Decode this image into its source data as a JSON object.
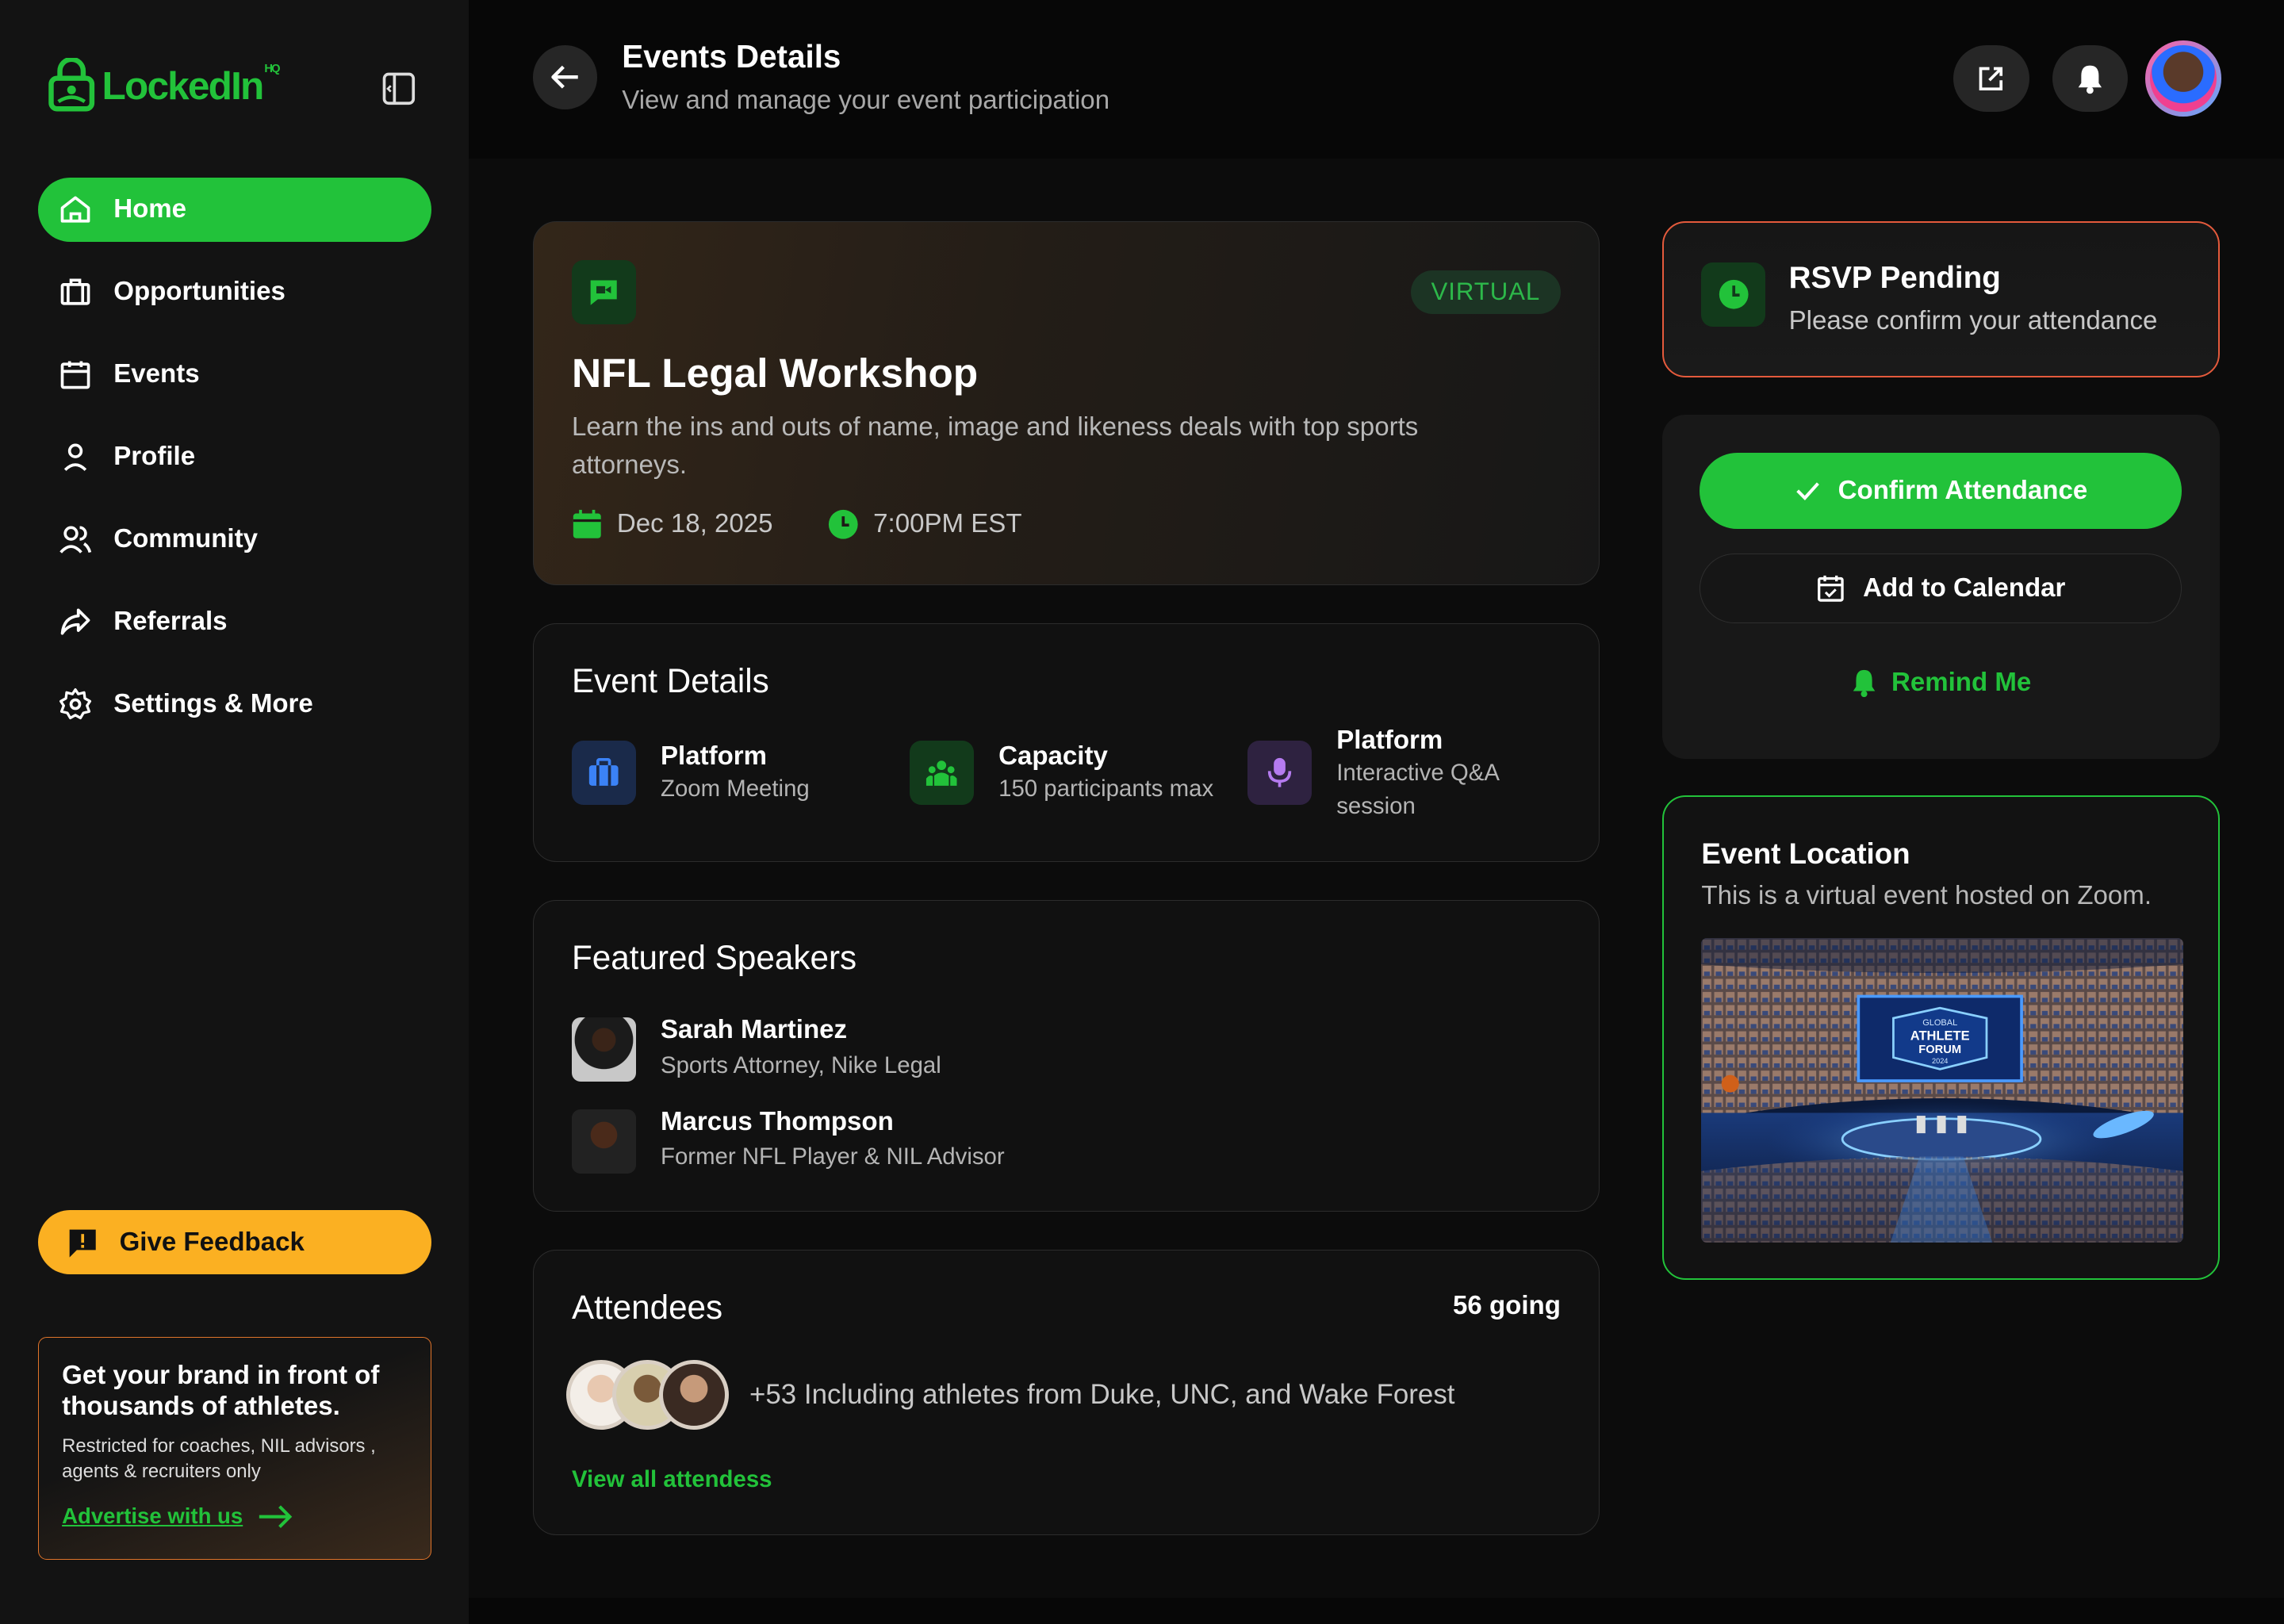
{
  "brand": {
    "name": "LockedIn",
    "superscript": "HQ"
  },
  "sidebar": {
    "items": [
      {
        "label": "Home",
        "icon": "home-icon",
        "active": true
      },
      {
        "label": "Opportunities",
        "icon": "briefcase-icon"
      },
      {
        "label": "Events",
        "icon": "calendar-icon"
      },
      {
        "label": "Profile",
        "icon": "user-icon"
      },
      {
        "label": "Community",
        "icon": "users-icon"
      },
      {
        "label": "Referrals",
        "icon": "share-icon"
      },
      {
        "label": "Settings & More",
        "icon": "gear-icon"
      }
    ],
    "feedback_label": "Give Feedback",
    "promo": {
      "title": "Get your brand in front of thousands of athletes.",
      "subtitle": "Restricted for coaches, NIL advisors , agents & recruiters only",
      "link": "Advertise with us"
    }
  },
  "header": {
    "title": "Events Details",
    "subtitle": "View and manage your event participation"
  },
  "event": {
    "badge": "VIRTUAL",
    "title": "NFL Legal Workshop",
    "description": "Learn the ins and outs of name, image and likeness deals with top sports attorneys.",
    "date": "Dec 18, 2025",
    "time": "7:00PM EST"
  },
  "details": {
    "title": "Event Details",
    "items": [
      {
        "label": "Platform",
        "value": "Zoom Meeting"
      },
      {
        "label": "Capacity",
        "value": "150 participants max"
      },
      {
        "label": "Platform",
        "value": "Interactive Q&A session"
      }
    ]
  },
  "speakers": {
    "title": "Featured Speakers",
    "items": [
      {
        "name": "Sarah Martinez",
        "role": "Sports Attorney, Nike Legal"
      },
      {
        "name": "Marcus Thompson",
        "role": "Former NFL Player & NIL Advisor"
      }
    ]
  },
  "attendees": {
    "title": "Attendees",
    "count": "56 going",
    "summary": "+53 Including athletes from Duke, UNC, and Wake Forest",
    "view_all": "View all attendess"
  },
  "rsvp": {
    "title": "RSVP Pending",
    "subtitle": "Please confirm your attendance"
  },
  "actions": {
    "confirm": "Confirm Attendance",
    "calendar": "Add to Calendar",
    "remind": "Remind Me"
  },
  "location": {
    "title": "Event Location",
    "subtitle": "This is a virtual event hosted on Zoom.",
    "image_text": [
      "GLOBAL",
      "ATHLETE",
      "FORUM",
      "2024"
    ]
  },
  "colors": {
    "accent": "#22c23a",
    "warning": "#fbb022",
    "rsvp_border": "#e45a3c"
  }
}
